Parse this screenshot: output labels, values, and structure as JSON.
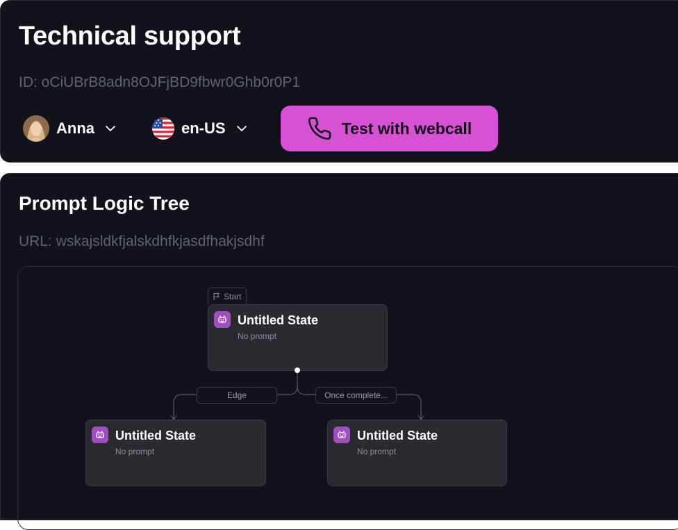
{
  "header": {
    "title": "Technical support",
    "id_label": "ID: oCiUBrB8adn8OJFjBD9fbwr0Ghb0r0P1",
    "agent": {
      "name": "Anna",
      "avatar_icon": "avatar-photo",
      "chevron_icon": "chevron-down-icon"
    },
    "language": {
      "code": "en-US",
      "flag_icon": "us-flag-icon",
      "chevron_icon": "chevron-down-icon"
    },
    "webcall_button": {
      "label": "Test with webcall",
      "icon": "phone-icon",
      "color": "#d651d4"
    }
  },
  "logic_tree": {
    "title": "Prompt Logic Tree",
    "url_label": "URL: wskajsldkfjalskdhfkjasdfhakjsdhf",
    "start_label": "Start",
    "nodes": [
      {
        "title": "Untitled State",
        "subtitle": "No prompt",
        "icon": "bot-icon"
      },
      {
        "title": "Untitled State",
        "subtitle": "No prompt",
        "icon": "bot-icon"
      },
      {
        "title": "Untitled State",
        "subtitle": "No prompt",
        "icon": "bot-icon"
      }
    ],
    "edges": [
      {
        "label": "Edge"
      },
      {
        "label": "Once complete..."
      }
    ]
  },
  "colors": {
    "background": "#12131a",
    "accent": "#d651d4",
    "node_bg": "#2a2b31",
    "node_icon_bg": "#a14fbe",
    "muted_text": "#5f6270"
  }
}
